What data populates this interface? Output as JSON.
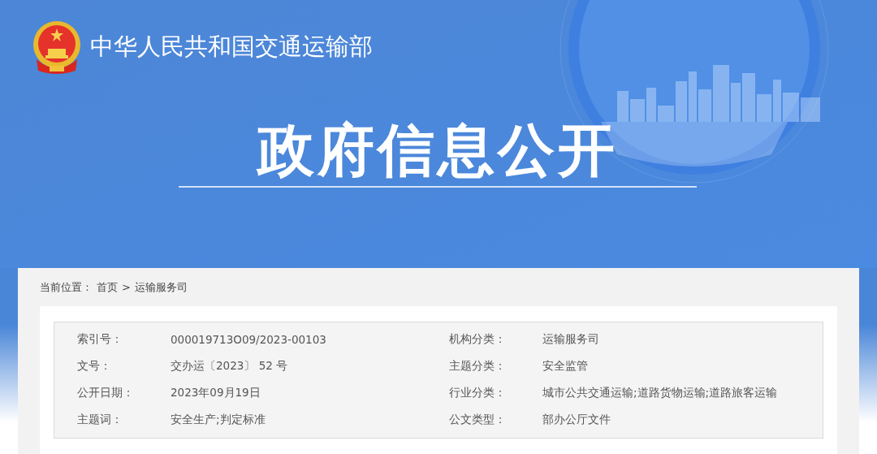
{
  "header": {
    "ministry_name": "中华人民共和国交通运输部",
    "title": "政府信息公开"
  },
  "breadcrumb": {
    "label": "当前位置：",
    "separator": ">",
    "items": [
      {
        "text": "首页"
      },
      {
        "text": "运输服务司"
      }
    ]
  },
  "metadata": [
    {
      "label": "索引号：",
      "value": "000019713O09/2023-00103"
    },
    {
      "label": "机构分类：",
      "value": "运输服务司"
    },
    {
      "label": "文号：",
      "value": "交办运〔2023〕 52 号"
    },
    {
      "label": "主题分类：",
      "value": "安全监管"
    },
    {
      "label": "公开日期：",
      "value": "2023年09月19日"
    },
    {
      "label": "行业分类：",
      "value": "城市公共交通运输;道路货物运输;道路旅客运输"
    },
    {
      "label": "主题词：",
      "value": "安全生产;判定标准"
    },
    {
      "label": "公文类型：",
      "value": "部办公厅文件"
    }
  ]
}
